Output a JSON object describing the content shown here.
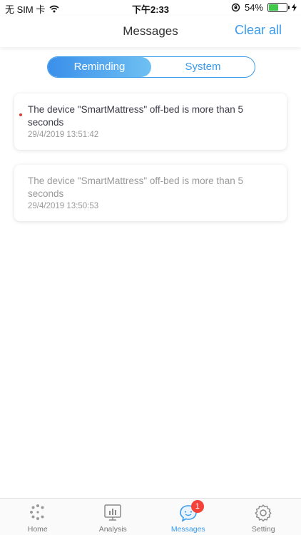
{
  "status_bar": {
    "carrier": "无 SIM 卡",
    "time": "下午2:33",
    "battery_percent": "54%",
    "battery_level": 0.54
  },
  "header": {
    "title": "Messages",
    "clear_all": "Clear all"
  },
  "segmented": {
    "reminding": "Reminding",
    "system": "System",
    "selected": "Reminding"
  },
  "messages": [
    {
      "text": "The device \"SmartMattress\"  off-bed is more than 5 seconds",
      "time": "29/4/2019 13:51:42",
      "unread": true
    },
    {
      "text": "The device \"SmartMattress\"  off-bed is more than 5 seconds",
      "time": "29/4/2019 13:50:53",
      "unread": false
    }
  ],
  "tabs": [
    {
      "label": "Home",
      "icon": "home-logo-icon"
    },
    {
      "label": "Analysis",
      "icon": "analysis-chart-icon"
    },
    {
      "label": "Messages",
      "icon": "messages-bubble-icon",
      "badge": "1",
      "active": true
    },
    {
      "label": "Setting",
      "icon": "gear-icon"
    }
  ],
  "colors": {
    "accent": "#3a9bec",
    "unread_dot": "#e23b2e",
    "badge": "#f2423a",
    "battery": "#41c74a"
  }
}
